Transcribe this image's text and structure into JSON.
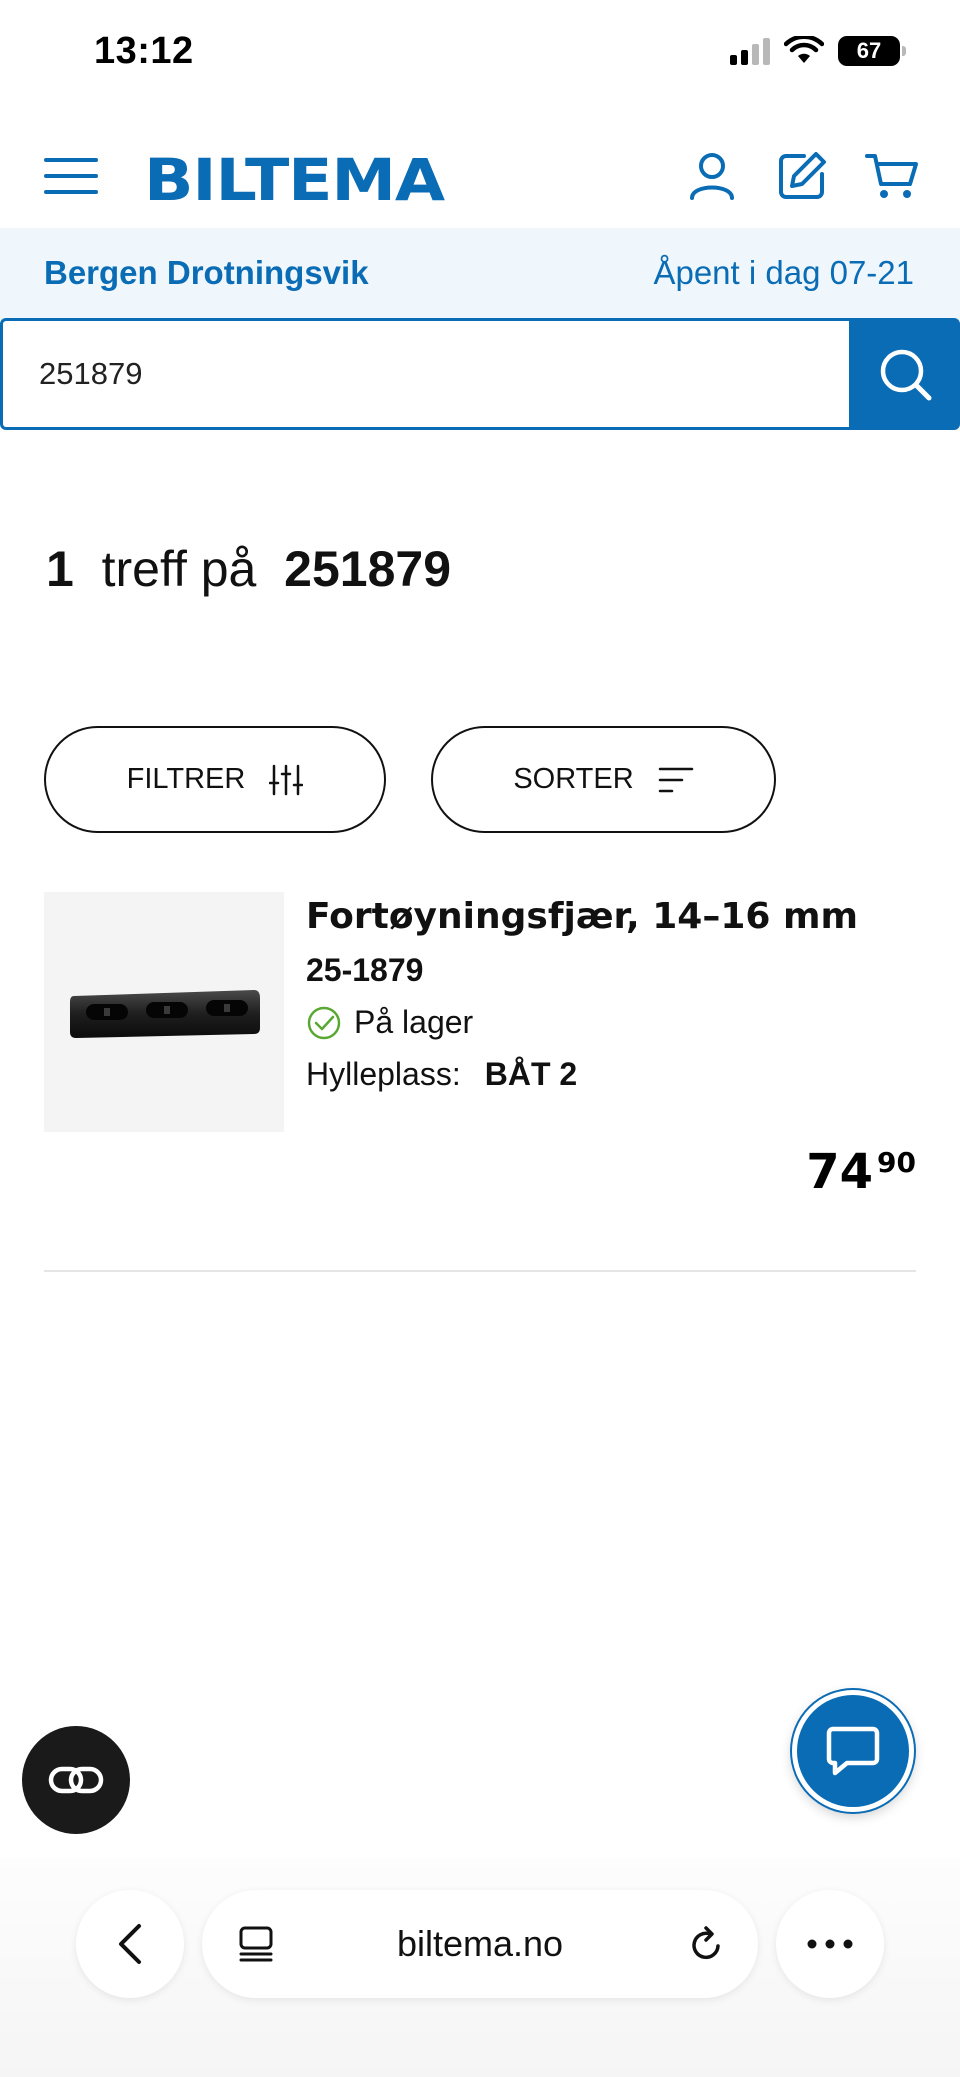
{
  "status_bar": {
    "time": "13:12",
    "battery": "67"
  },
  "header": {
    "logo": "BILTEMA",
    "icons": [
      "menu-icon",
      "user-icon",
      "edit-icon",
      "cart-icon"
    ]
  },
  "store": {
    "name": "Bergen Drotningsvik",
    "hours": "Åpent i dag 07-21"
  },
  "search": {
    "value": "251879"
  },
  "results": {
    "count": "1",
    "text": "treff på",
    "query": "251879"
  },
  "controls": {
    "filter_label": "FILTRER",
    "sort_label": "SORTER"
  },
  "product": {
    "name": "Fortøyningsfjær, 14–16 mm",
    "sku": "25-1879",
    "stock": "På lager",
    "shelf_label": "Hylleplass:",
    "shelf_value": "BÅT 2",
    "price_main": "74",
    "price_dec": "90"
  },
  "browser": {
    "url": "biltema.no"
  },
  "colors": {
    "brand": "#0a6cb5",
    "stock_green": "#5aa832",
    "store_bar_bg": "#eff6fc"
  }
}
